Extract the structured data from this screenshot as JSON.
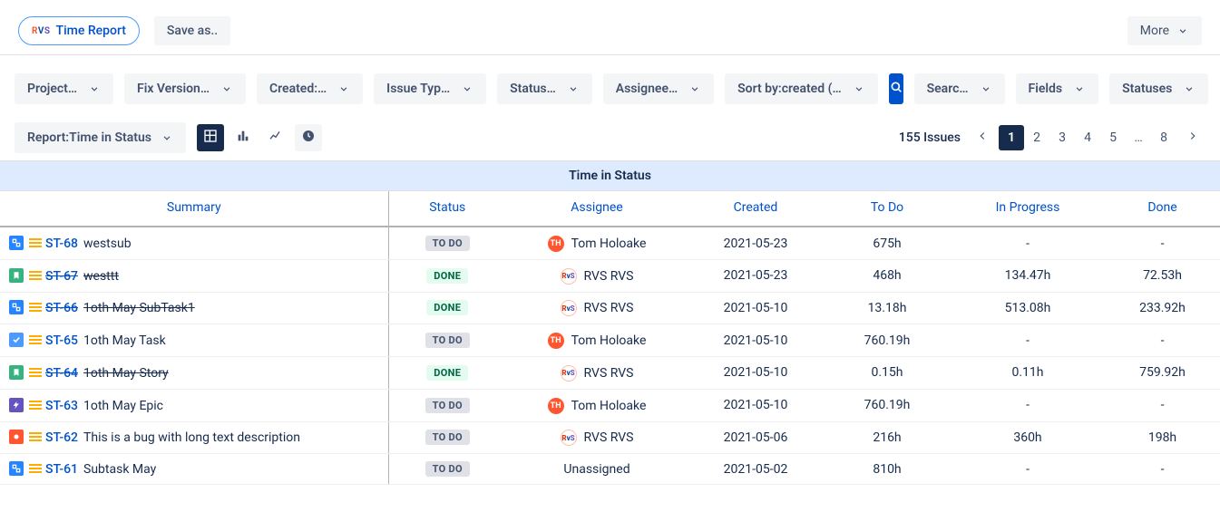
{
  "toolbar": {
    "time_report_label": "Time Report",
    "save_as_label": "Save as..",
    "more_label": "More"
  },
  "filters": {
    "project": "Project…",
    "fix_version": "Fix Version…",
    "created": "Created:…",
    "issue_type": "Issue Typ…",
    "status": "Status…",
    "assignee": "Assignee…",
    "sort": "Sort by:created (…",
    "search_more": "Searc…",
    "fields": "Fields",
    "statuses": "Statuses"
  },
  "report": {
    "label": "Report:Time in Status"
  },
  "pager": {
    "count_label": "155 Issues",
    "pages": [
      "1",
      "2",
      "3",
      "4",
      "5",
      "…",
      "8"
    ],
    "current": "1"
  },
  "table": {
    "title": "Time in Status",
    "columns": [
      "Summary",
      "Status",
      "Assignee",
      "Created",
      "To Do",
      "In Progress",
      "Done"
    ],
    "rows": [
      {
        "icon": "subtask",
        "key": "ST-68",
        "summary": "westsub",
        "resolved": false,
        "status": "TO DO",
        "assignee": {
          "kind": "user",
          "initials": "TH",
          "name": "Tom Holoake"
        },
        "created": "2021-05-23",
        "todo": "675h",
        "inprog": "-",
        "done": "-"
      },
      {
        "icon": "story",
        "key": "ST-67",
        "summary": "westtt",
        "resolved": true,
        "status": "DONE",
        "assignee": {
          "kind": "rvs",
          "name": "RVS RVS"
        },
        "created": "2021-05-23",
        "todo": "468h",
        "inprog": "134.47h",
        "done": "72.53h"
      },
      {
        "icon": "subtask",
        "key": "ST-66",
        "summary": "1oth May SubTask1",
        "resolved": true,
        "status": "DONE",
        "assignee": {
          "kind": "rvs",
          "name": "RVS RVS"
        },
        "created": "2021-05-10",
        "todo": "13.18h",
        "inprog": "513.08h",
        "done": "233.92h"
      },
      {
        "icon": "task",
        "key": "ST-65",
        "summary": "1oth May Task",
        "resolved": false,
        "status": "TO DO",
        "assignee": {
          "kind": "user",
          "initials": "TH",
          "name": "Tom Holoake"
        },
        "created": "2021-05-10",
        "todo": "760.19h",
        "inprog": "-",
        "done": "-"
      },
      {
        "icon": "story",
        "key": "ST-64",
        "summary": "1oth May Story",
        "resolved": true,
        "status": "DONE",
        "assignee": {
          "kind": "rvs",
          "name": "RVS RVS"
        },
        "created": "2021-05-10",
        "todo": "0.15h",
        "inprog": "0.11h",
        "done": "759.92h"
      },
      {
        "icon": "epic",
        "key": "ST-63",
        "summary": "1oth May Epic",
        "resolved": false,
        "status": "TO DO",
        "assignee": {
          "kind": "user",
          "initials": "TH",
          "name": "Tom Holoake"
        },
        "created": "2021-05-10",
        "todo": "760.19h",
        "inprog": "-",
        "done": "-"
      },
      {
        "icon": "bug",
        "key": "ST-62",
        "summary": "This is a bug with long text description",
        "resolved": false,
        "status": "TO DO",
        "assignee": {
          "kind": "rvs",
          "name": "RVS RVS"
        },
        "created": "2021-05-06",
        "todo": "216h",
        "inprog": "360h",
        "done": "198h"
      },
      {
        "icon": "subtask",
        "key": "ST-61",
        "summary": "Subtask May",
        "resolved": false,
        "status": "TO DO",
        "assignee": {
          "kind": "none",
          "name": "Unassigned"
        },
        "created": "2021-05-02",
        "todo": "810h",
        "inprog": "-",
        "done": "-"
      }
    ]
  }
}
